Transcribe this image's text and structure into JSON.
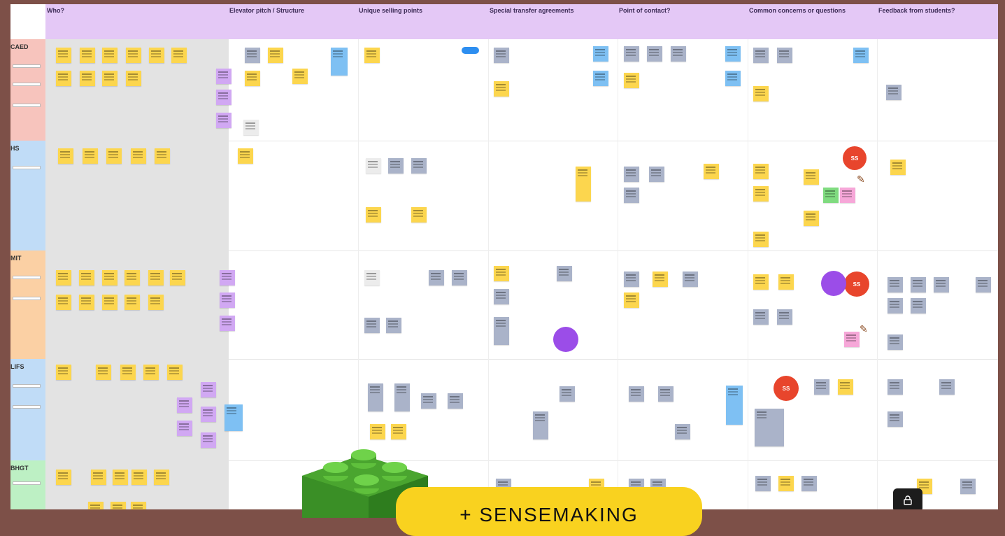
{
  "columns": [
    "Who?",
    "Elevator pitch / Structure",
    "Unique selling points",
    "Special transfer agreements",
    "Point of contact?",
    "Common concerns or questions",
    "Feedback from students?"
  ],
  "lanes": [
    "CAED",
    "HS",
    "MIT",
    "LIFS",
    "BHGT"
  ],
  "badges": [
    "SS",
    "SS",
    "SS"
  ],
  "banner": {
    "text": "+ SENSEMAKING"
  },
  "icons": {
    "lock": "lock-icon",
    "brick": "lego-brick-icon",
    "pin": "pushpin-icon"
  },
  "colors": {
    "frame": "#7d5048",
    "header": "#e4c8f6",
    "sticky": "#fcd64e",
    "badge": "#e8452c",
    "banner": "#f9d21f"
  }
}
